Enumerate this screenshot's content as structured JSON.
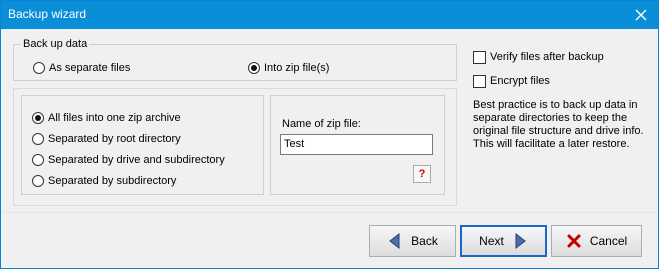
{
  "window": {
    "title": "Backup wizard",
    "accent": "#0a8ed8"
  },
  "backup_group": {
    "title": "Back up data",
    "options": [
      {
        "label": "As separate files",
        "checked": false
      },
      {
        "label": "Into zip file(s)",
        "checked": true
      }
    ]
  },
  "zip_options": {
    "options": [
      {
        "label": "All files into one zip archive",
        "checked": true
      },
      {
        "label": "Separated by root directory",
        "checked": false
      },
      {
        "label": "Separated by drive and subdirectory",
        "checked": false
      },
      {
        "label": "Separated by subdirectory",
        "checked": false
      }
    ]
  },
  "zip_name": {
    "label": "Name of zip file:",
    "value": "Test",
    "help_label": "?"
  },
  "side_options": {
    "verify_label": "Verify files after backup",
    "verify_checked": false,
    "encrypt_label": "Encrypt files",
    "encrypt_checked": false,
    "hint": "Best practice is to back up data in separate directories to keep the original file structure and drive info. This will facilitate a later restore."
  },
  "buttons": {
    "back": "Back",
    "next": "Next",
    "cancel": "Cancel"
  },
  "icons": {
    "close": "close-icon",
    "back": "arrow-left-icon",
    "next": "arrow-right-icon",
    "cancel": "red-x-icon"
  }
}
